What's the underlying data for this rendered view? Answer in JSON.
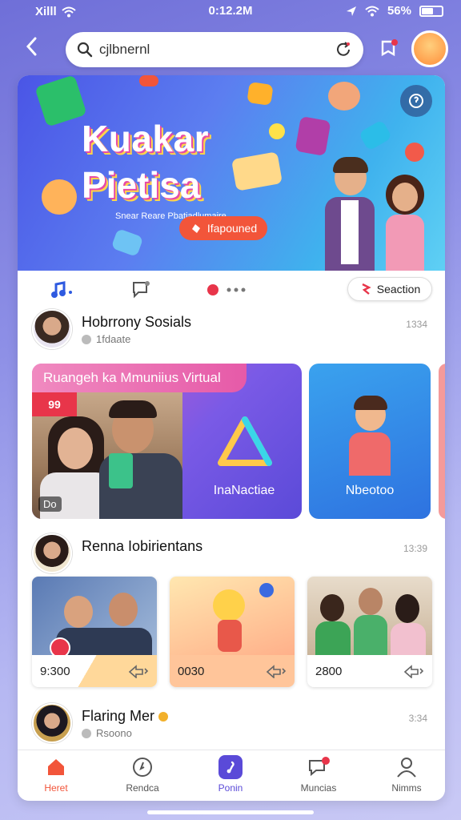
{
  "status_bar": {
    "carrier": "Xilll",
    "time": "0:12.2M",
    "battery": "56%"
  },
  "search": {
    "query": "cjlbnernl"
  },
  "banner": {
    "title_line1": "Kuakar",
    "title_line2": "Pietisa",
    "subtitle": "Snear Reare Pbatiadlumaire",
    "cta_label": "Ifapounеd"
  },
  "icon_row": {
    "section_label": "Seaction"
  },
  "posts": [
    {
      "name": "Hobrrony Sosials",
      "meta": "1fdaate",
      "time": "1334"
    },
    {
      "name": "Renna Iobirientans",
      "meta": "",
      "time": "13:39"
    },
    {
      "name": "Flaring Mer",
      "meta": "Rsoono",
      "time": "3:34"
    }
  ],
  "featured": {
    "banner_label": "Ruangeh ka Mmuniius Virtual",
    "badge": "99",
    "counter": "Do",
    "big_caption": "InaNactiae",
    "small_caption": "Nbeotoo"
  },
  "tiles": [
    {
      "value": "9:300"
    },
    {
      "value": "0030"
    },
    {
      "value": "2800"
    }
  ],
  "bottom_nav": [
    {
      "label": "Heret"
    },
    {
      "label": "Rendca"
    },
    {
      "label": "Ponin"
    },
    {
      "label": "Muncias"
    },
    {
      "label": "Nimms"
    }
  ],
  "colors": {
    "accent": "#5a4ad8",
    "home_active": "#f2553a",
    "badge_red": "#e8354a"
  }
}
